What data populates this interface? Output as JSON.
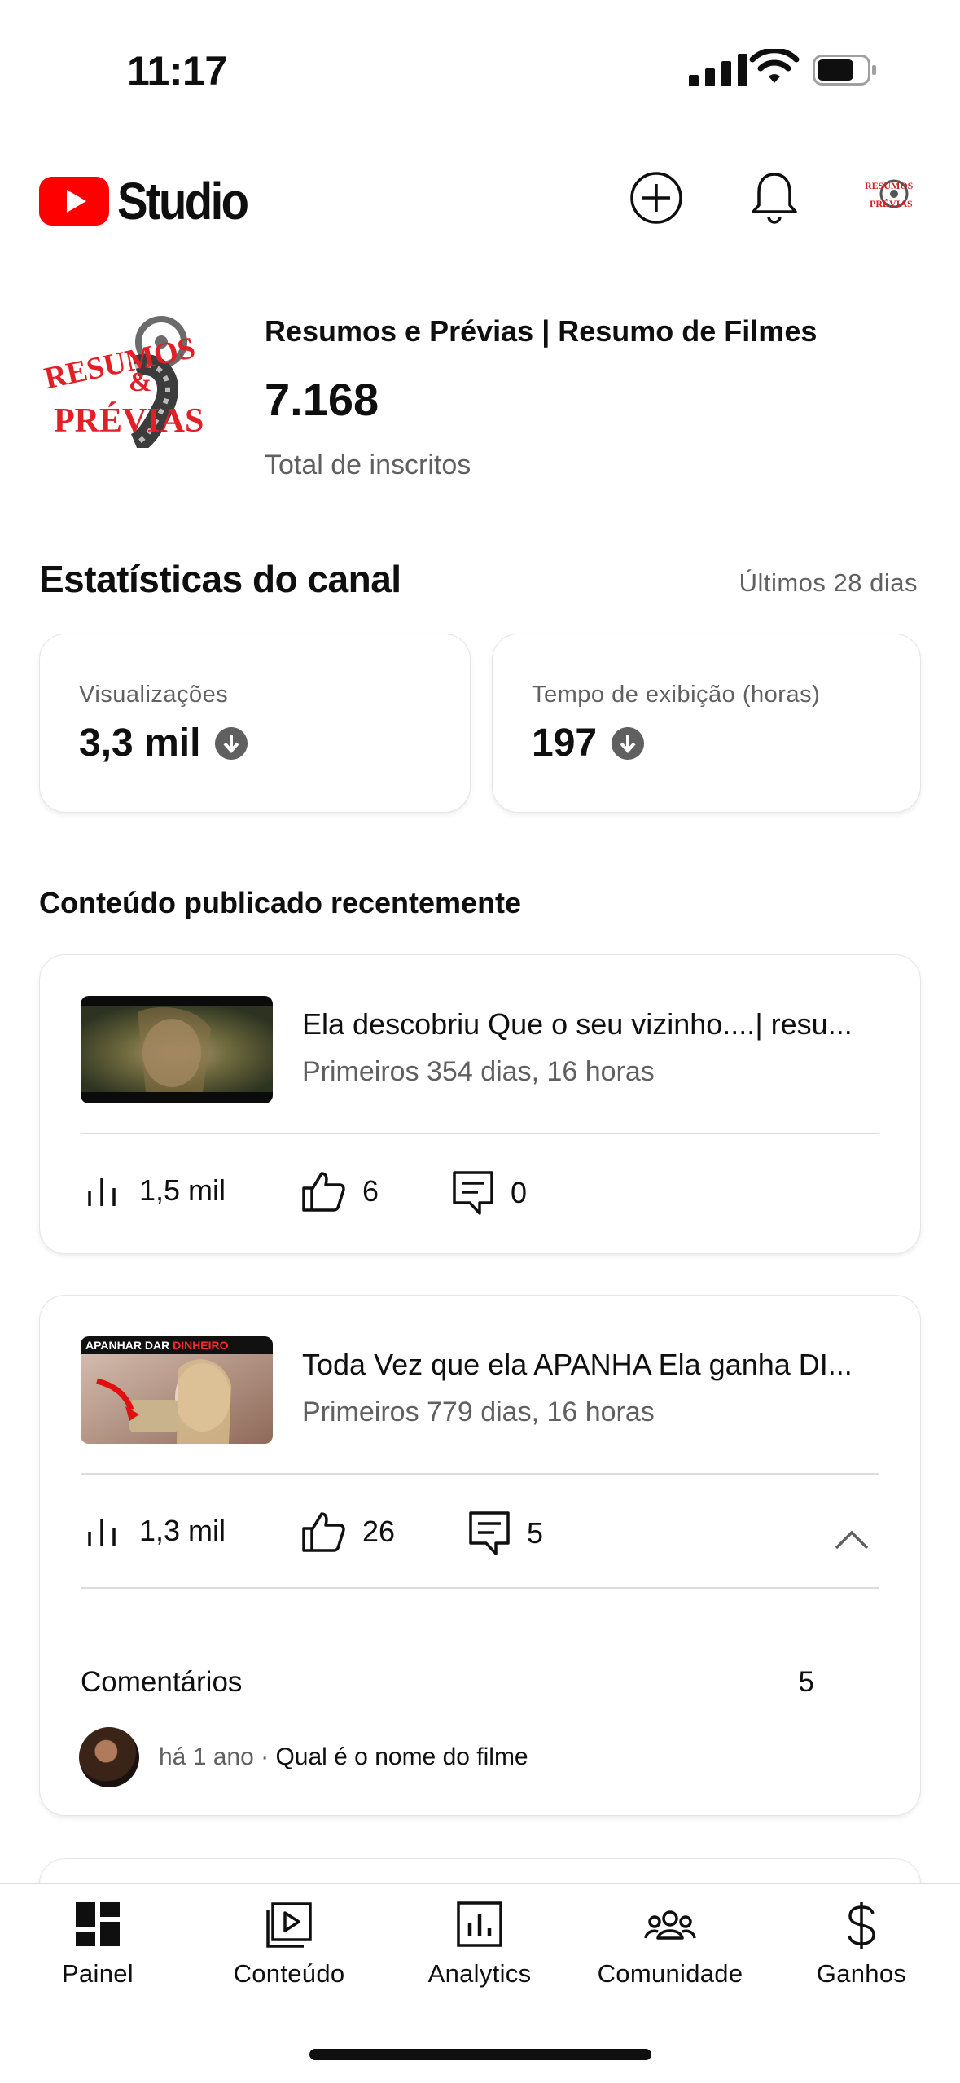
{
  "status_bar": {
    "time": "11:17"
  },
  "header": {
    "logo_text": "Studio"
  },
  "channel": {
    "name": "Resumos e Prévias | Resumo de Filmes",
    "subscribers": "7.168",
    "subscribers_label": "Total de inscritos",
    "logo_text_top": "RESUMOS",
    "logo_text_bottom": "PRÉVIAS"
  },
  "stats": {
    "title": "Estatísticas do canal",
    "period": "Últimos 28 dias",
    "cards": [
      {
        "label": "Visualizações",
        "value": "3,3 mil"
      },
      {
        "label": "Tempo de exibição (horas)",
        "value": "197"
      }
    ]
  },
  "recent": {
    "title": "Conteúdo publicado recentemente",
    "videos": [
      {
        "title": "Ela descobriu Que o seu vizinho....| resu...",
        "period": "Primeiros 354 dias, 16 horas",
        "views": "1,5 mil",
        "likes": "6",
        "comments": "0"
      },
      {
        "title": "Toda Vez que ela APANHA Ela ganha DI...",
        "period": "Primeiros 779 dias, 16 horas",
        "views": "1,3 mil",
        "likes": "26",
        "comments": "5",
        "thumb_text_a": "APANHAR DAR ",
        "thumb_text_b": "DINHEIRO",
        "comments_section": {
          "label": "Comentários",
          "count": "5",
          "latest_time": "há 1 ano",
          "latest_text": "Qual é o nome do filme"
        }
      }
    ]
  },
  "nav": {
    "items": [
      {
        "label": "Painel",
        "icon": "dashboard-icon"
      },
      {
        "label": "Conteúdo",
        "icon": "content-icon"
      },
      {
        "label": "Analytics",
        "icon": "analytics-icon"
      },
      {
        "label": "Comunidade",
        "icon": "community-icon"
      },
      {
        "label": "Ganhos",
        "icon": "earn-icon"
      }
    ]
  },
  "colors": {
    "brand_red": "#ff0000",
    "text": "#0f0f0f",
    "secondary": "#606060"
  }
}
